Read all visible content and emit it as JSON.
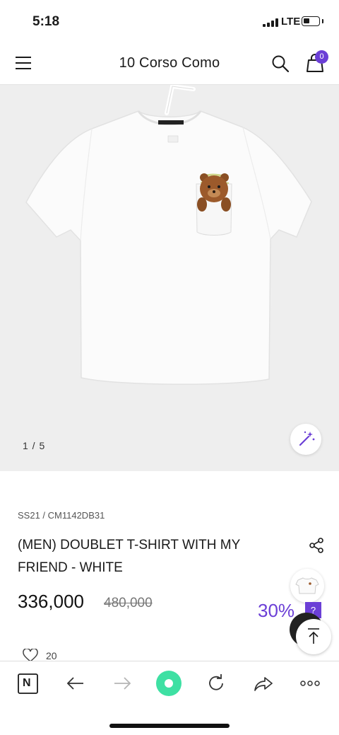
{
  "status_bar": {
    "time": "5:18",
    "network": "LTE"
  },
  "header": {
    "title": "10 Corso Como",
    "cart_count": "0"
  },
  "gallery": {
    "counter": "1 / 5"
  },
  "product": {
    "code": "SS21 / CM1142DB31",
    "name": "(MEN) DOUBLET T-SHIRT WITH MY FRIEND - WHITE",
    "price": "336,000",
    "original_price": "480,000",
    "discount": "30%",
    "discount_help": "?",
    "likes": "20"
  },
  "colors": {
    "accent": "#6b3fd6",
    "toolbar_green": "#3ee0a3"
  },
  "toolbar": {
    "icons": [
      "naver-logo-icon",
      "back-arrow-icon",
      "forward-arrow-icon",
      "green-dot-icon",
      "reload-icon",
      "share-arrow-icon",
      "more-dots-icon"
    ],
    "logo_letter": "N"
  }
}
